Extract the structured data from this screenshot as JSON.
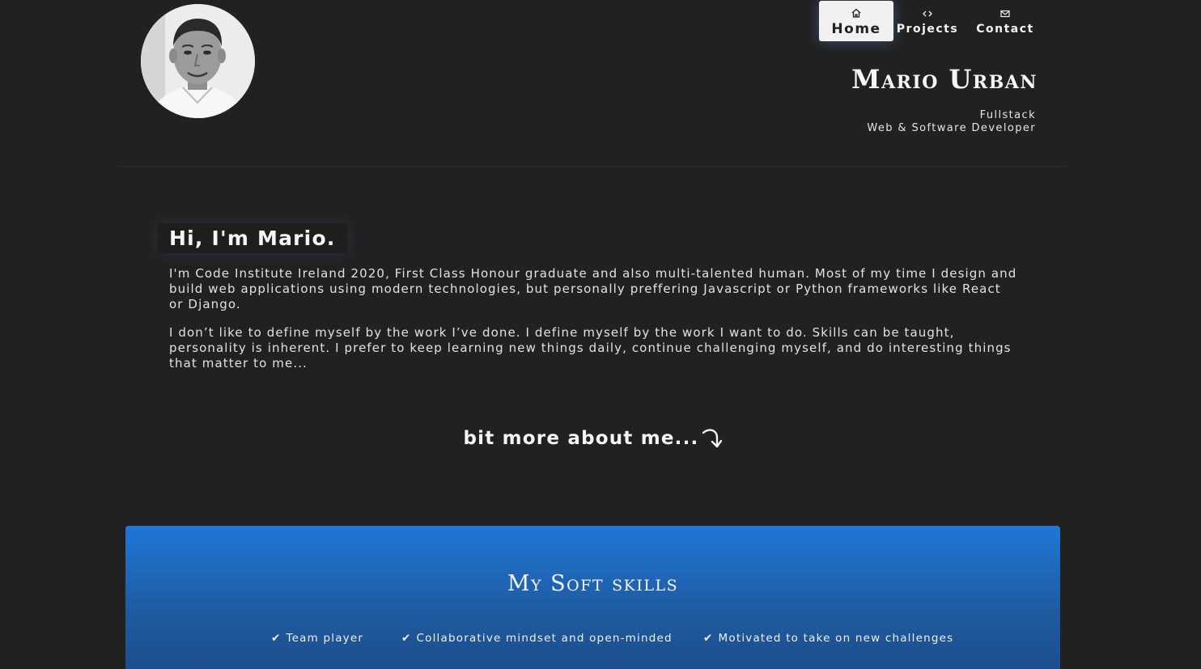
{
  "header": {
    "avatar_alt": "Mario Urban portrait",
    "name": "Mario Urban",
    "subtitle_line1": "Fullstack",
    "subtitle_line2": "Web & Software Developer"
  },
  "nav": {
    "items": [
      {
        "label": "Home",
        "icon": "home-icon",
        "active": true
      },
      {
        "label": "Projects",
        "icon": "code-icon",
        "active": false
      },
      {
        "label": "Contact",
        "icon": "mail-icon",
        "active": false
      }
    ]
  },
  "intro": {
    "heading": "Hi, I'm Mario.",
    "paragraph1": "I'm Code Institute Ireland 2020, First Class Honour graduate and also multi-talented human. Most of my time I design and build web applications using modern technologies, but personally preffering Javascript or Python frameworks like React or Django.",
    "paragraph2": "I don’t like to define myself by the work I’ve done. I define myself by the work I want to do. Skills can be taught, personality is inherent. I prefer to keep learning new things daily, continue challenging myself, and do interesting things that matter to me..."
  },
  "more_link": {
    "label": "bit more about me...",
    "icon": "curved-arrow-icon"
  },
  "soft_skills": {
    "title": "My Soft skills",
    "check_glyph": "✔",
    "items": [
      "Team player",
      "Collaborative mindset and open-minded",
      "Motivated to take on new challenges"
    ]
  },
  "colors": {
    "background": "#212121",
    "panel_top": "#2176d6",
    "panel_bottom": "#1c4a85",
    "text": "#eeeeee"
  }
}
